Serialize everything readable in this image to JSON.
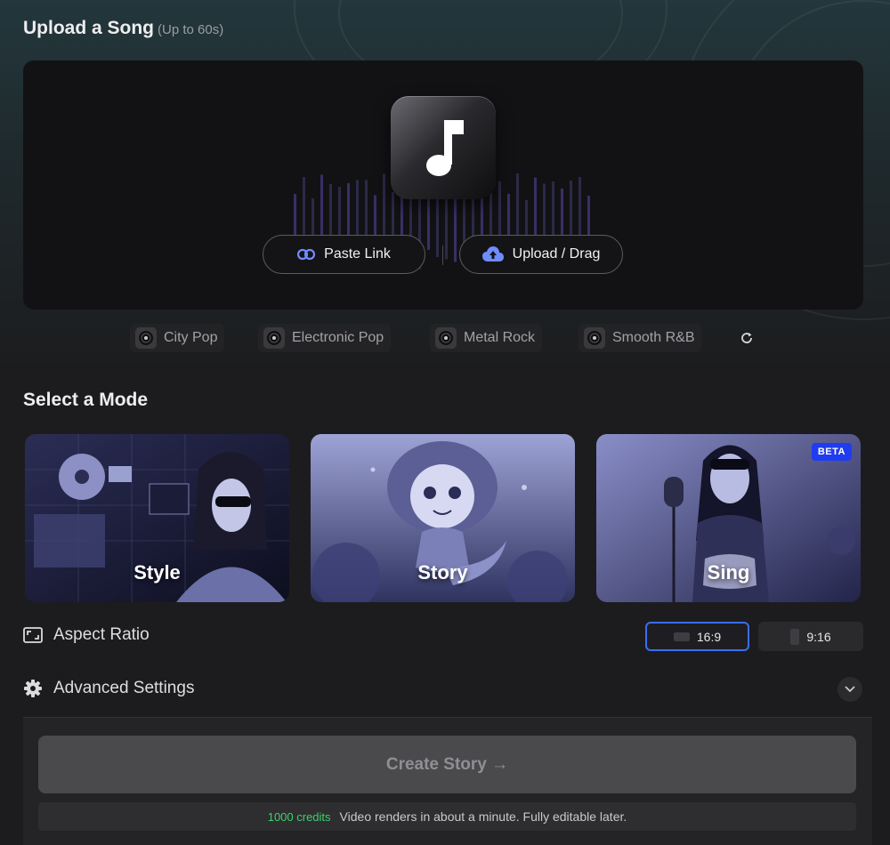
{
  "upload": {
    "title": "Upload a Song",
    "subtitle": "(Up to 60s)",
    "paste_label": "Paste Link",
    "upload_label": "Upload / Drag"
  },
  "genres": [
    {
      "label": "City Pop"
    },
    {
      "label": "Electronic Pop"
    },
    {
      "label": "Metal Rock"
    },
    {
      "label": "Smooth R&B"
    }
  ],
  "modes": {
    "title": "Select a Mode",
    "cards": [
      {
        "label": "Style"
      },
      {
        "label": "Story"
      },
      {
        "label": "Sing",
        "badge": "BETA"
      }
    ]
  },
  "aspect": {
    "label": "Aspect Ratio",
    "options": [
      {
        "label": "16:9",
        "selected": true
      },
      {
        "label": "9:16",
        "selected": false
      }
    ]
  },
  "advanced": {
    "label": "Advanced Settings"
  },
  "create": {
    "button_label": "Create Story →",
    "credits": "1000 credits",
    "note": "Video renders in about a minute. Fully editable later."
  },
  "colors": {
    "accent_blue": "#3b6df0",
    "beta_badge": "#1f3cf0",
    "credits_green": "#3bd16f"
  },
  "icons": [
    "music-note-icon",
    "link-icon",
    "cloud-upload-icon",
    "vinyl-disc-icon",
    "refresh-icon",
    "aspect-ratio-icon",
    "gear-icon",
    "chevron-down-icon"
  ]
}
